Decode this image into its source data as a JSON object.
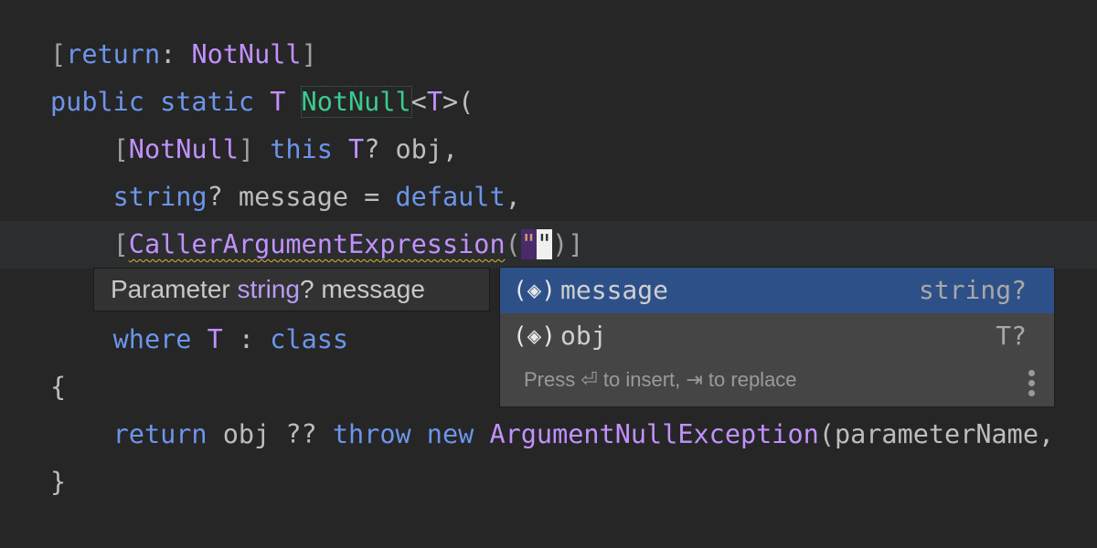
{
  "code_lines": [
    [
      {
        "t": "[",
        "c": "br"
      },
      {
        "t": "return",
        "c": "kw"
      },
      {
        "t": ": ",
        "c": "pl"
      },
      {
        "t": "NotNull",
        "c": "ty"
      },
      {
        "t": "]",
        "c": "br"
      }
    ],
    [
      {
        "t": "public static ",
        "c": "kw"
      },
      {
        "t": "T ",
        "c": "ty"
      },
      {
        "t": "NotNull",
        "c": "fn"
      },
      {
        "t": "<",
        "c": "pl"
      },
      {
        "t": "T",
        "c": "ty"
      },
      {
        "t": ">(",
        "c": "pl"
      }
    ],
    [
      {
        "t": "    [",
        "c": "br"
      },
      {
        "t": "NotNull",
        "c": "ty"
      },
      {
        "t": "] ",
        "c": "br"
      },
      {
        "t": "this ",
        "c": "kw"
      },
      {
        "t": "T",
        "c": "ty"
      },
      {
        "t": "? obj,",
        "c": "pl"
      }
    ],
    [
      {
        "t": "    ",
        "c": "pl"
      },
      {
        "t": "string",
        "c": "kw"
      },
      {
        "t": "? message = ",
        "c": "pl"
      },
      {
        "t": "default",
        "c": "kw"
      },
      {
        "t": ",",
        "c": "pl"
      }
    ],
    [
      {
        "t": "    [",
        "c": "br"
      },
      {
        "t": "CallerArgumentExpression",
        "c": "ty squig"
      },
      {
        "t": "(",
        "c": "br"
      },
      {
        "t": "\"",
        "c": "str caret-box"
      },
      {
        "t": "\"",
        "c": "caret"
      },
      {
        "t": ")]",
        "c": "br"
      }
    ],
    [],
    [
      {
        "t": "    ",
        "c": "pl"
      },
      {
        "t": "where ",
        "c": "kw"
      },
      {
        "t": "T",
        "c": "ty"
      },
      {
        "t": " : ",
        "c": "pl"
      },
      {
        "t": "class",
        "c": "kw"
      }
    ],
    [
      {
        "t": "{",
        "c": "pl"
      }
    ],
    [
      {
        "t": "    ",
        "c": "pl"
      },
      {
        "t": "return ",
        "c": "kw"
      },
      {
        "t": "obj ?? ",
        "c": "pl"
      },
      {
        "t": "throw new ",
        "c": "kw"
      },
      {
        "t": "ArgumentNullException",
        "c": "ty"
      },
      {
        "t": "(parameterName,",
        "c": "pl"
      }
    ],
    [
      {
        "t": "}",
        "c": "pl"
      }
    ]
  ],
  "tooltip": {
    "prefix": "Parameter ",
    "type": "string",
    "suffix": "? message"
  },
  "completion": {
    "items": [
      {
        "icon": "parameter-icon",
        "glyph": "(◈)",
        "name": "message",
        "type": "string?",
        "selected": true
      },
      {
        "icon": "parameter-icon",
        "glyph": "(◈)",
        "name": "obj",
        "type": "T?",
        "selected": false
      }
    ],
    "hint": "Press ⏎ to insert, ⇥ to replace"
  },
  "colors": {
    "background": "#262626",
    "keyword": "#6c95eb",
    "type": "#c191ff",
    "method": "#39cc8f",
    "selection": "#2e5088"
  }
}
